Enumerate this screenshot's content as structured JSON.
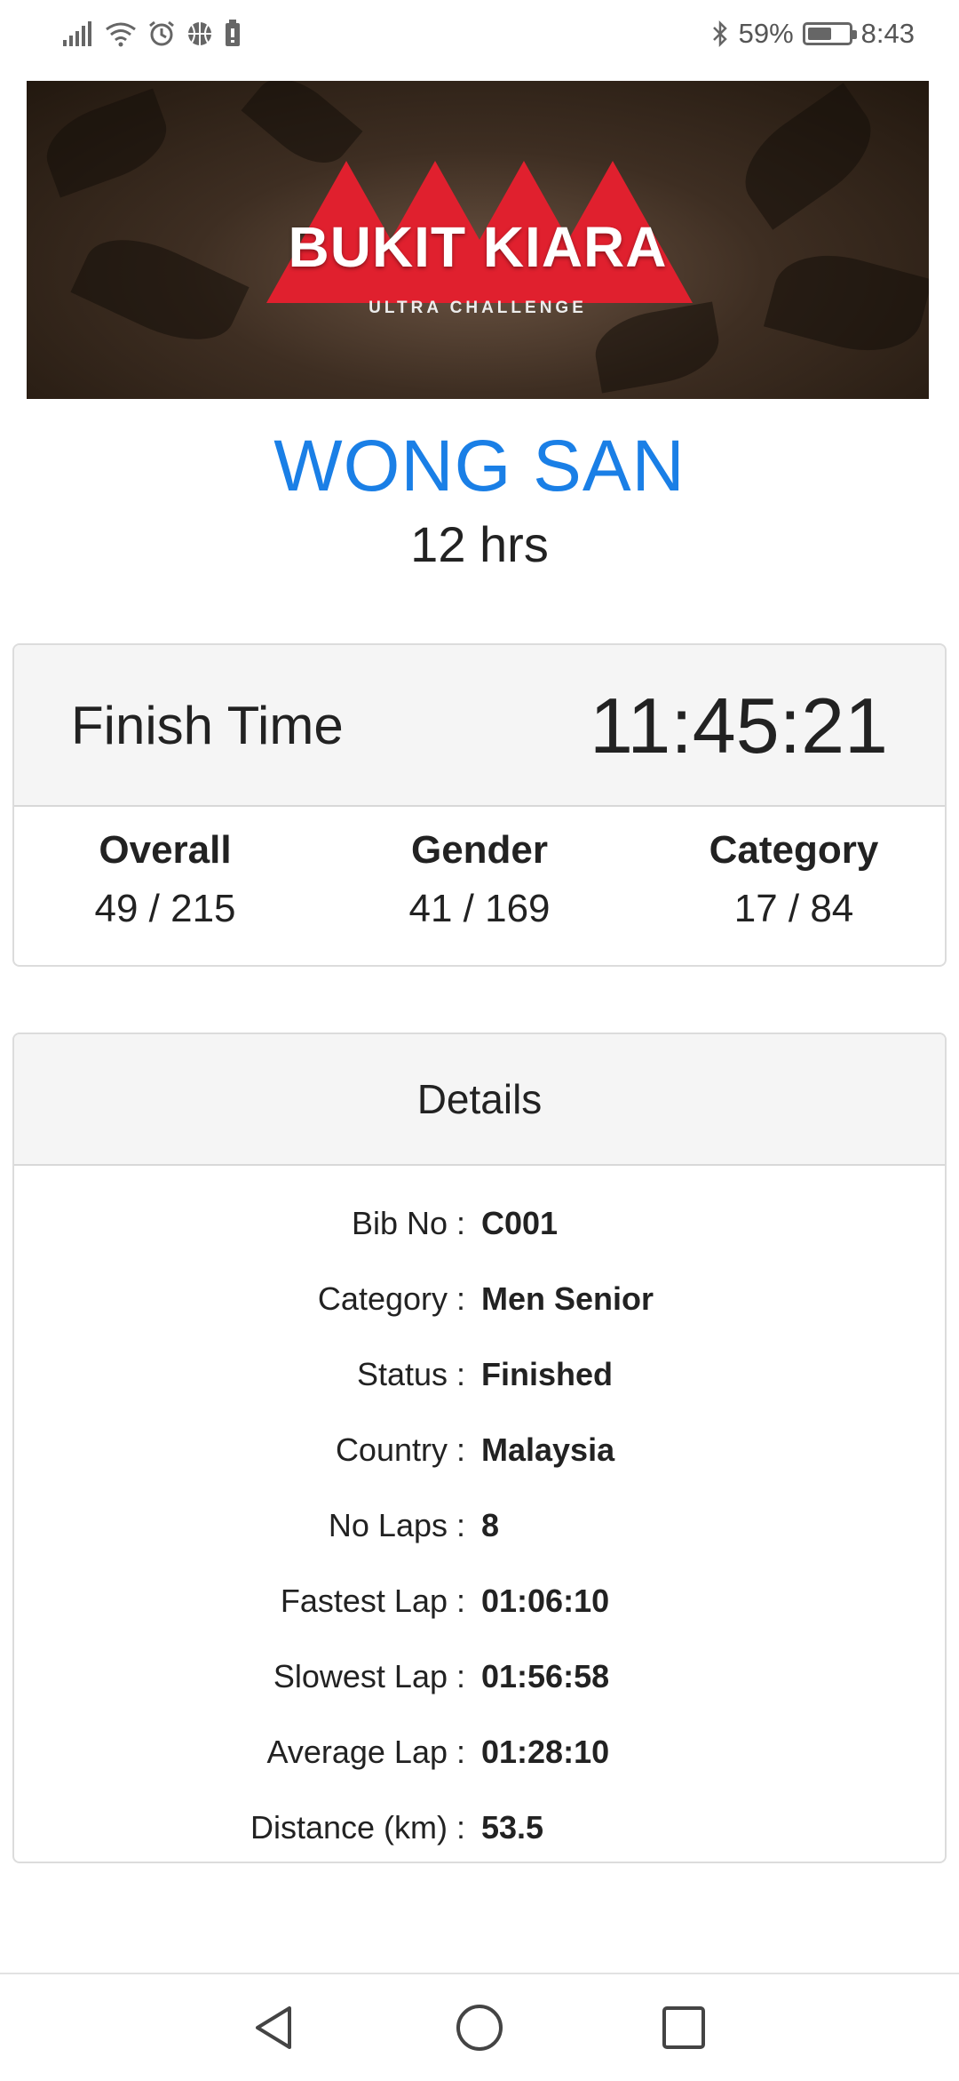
{
  "status_bar": {
    "battery_percent_text": "59%",
    "battery_level": 0.59,
    "time": "8:43",
    "icons": [
      "signal-icon",
      "wifi-icon",
      "alarm-icon",
      "basketball-icon",
      "sim-battery-icon",
      "bluetooth-icon",
      "battery-icon"
    ]
  },
  "banner": {
    "title": "BUKIT KIARA",
    "subtitle": "ULTRA CHALLENGE",
    "accent_color": "#e0202e"
  },
  "runner": {
    "name": "WONG SAN",
    "event": "12 hrs",
    "name_color": "#1a7fe6"
  },
  "finish": {
    "label": "Finish Time",
    "time": "11:45:21",
    "ranks": [
      {
        "label": "Overall",
        "value": "49 / 215"
      },
      {
        "label": "Gender",
        "value": "41 / 169"
      },
      {
        "label": "Category",
        "value": "17 / 84"
      }
    ]
  },
  "details": {
    "title": "Details",
    "rows": [
      {
        "label": "Bib No :",
        "value": "C001"
      },
      {
        "label": "Category :",
        "value": "Men Senior"
      },
      {
        "label": "Status :",
        "value": "Finished"
      },
      {
        "label": "Country :",
        "value": "Malaysia"
      },
      {
        "label": "No Laps :",
        "value": "8"
      },
      {
        "label": "Fastest Lap :",
        "value": "01:06:10"
      },
      {
        "label": "Slowest Lap :",
        "value": "01:56:58"
      },
      {
        "label": "Average Lap :",
        "value": "01:28:10"
      },
      {
        "label": "Distance (km) :",
        "value": "53.5"
      }
    ]
  },
  "nav": {
    "icons": [
      "back-icon",
      "home-icon",
      "recents-icon"
    ]
  }
}
